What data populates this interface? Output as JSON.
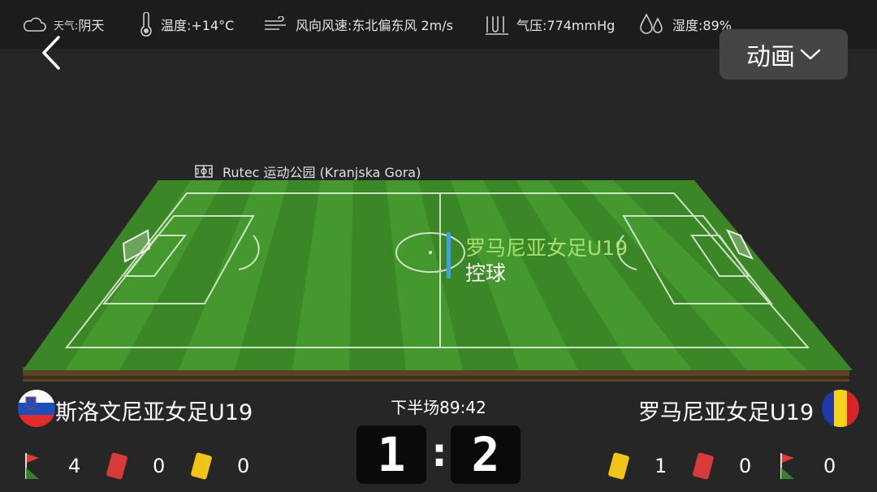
{
  "weather": {
    "weather_label": "天气:",
    "weather_value": "阴天",
    "temperature": "温度:+14°C",
    "wind": "风向风速:东北偏东风 2m/s",
    "pressure": "气压:774mmHg",
    "humidity": "湿度:89%"
  },
  "nav": {
    "animation_label": "动画"
  },
  "stadium": {
    "name": "Rutec 运动公园 (Kranjska Gora)"
  },
  "possession": {
    "team": "罗马尼亚女足U19",
    "label": "控球"
  },
  "home": {
    "name": "斯洛文尼亚女足U19",
    "flag_colors": [
      "#ffffff",
      "#1c4fb8",
      "#e32b2b"
    ],
    "corners": "4",
    "red_cards": "0",
    "yellow_cards": "0"
  },
  "away": {
    "name": "罗马尼亚女足U19",
    "flag_colors": [
      "#1f3aa8",
      "#f6d21a",
      "#d8232f"
    ],
    "yellow_cards": "1",
    "red_cards": "0",
    "corners": "0"
  },
  "match": {
    "time": "下半场89:42",
    "home_score": "1",
    "away_score": "2",
    "separator": ":"
  },
  "colors": {
    "field_green": "#3f8a2a",
    "possession_bar": "#3ea0e8",
    "possession_team": "#a8e070",
    "background": "#262626"
  }
}
